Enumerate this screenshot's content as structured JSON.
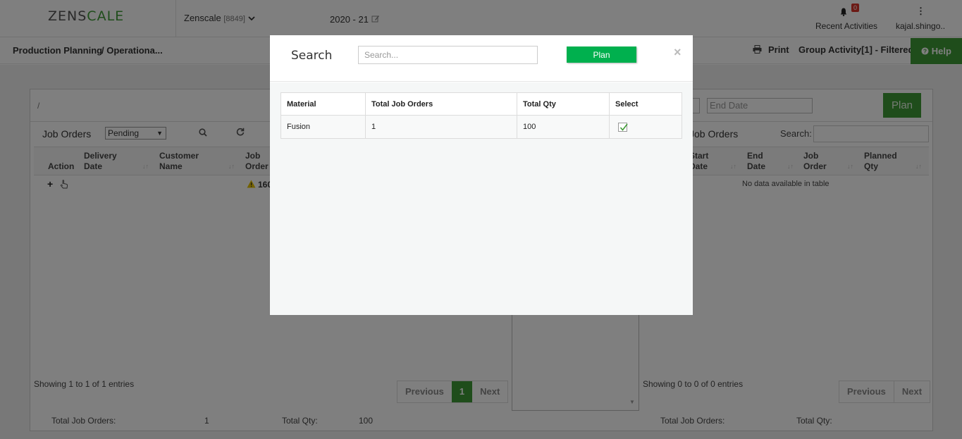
{
  "header": {
    "logo_left": "ZENS",
    "logo_right": "C",
    "logo_tail": "ALE",
    "company_name": "Zenscale",
    "company_code": "[8849]",
    "fiscal_year": "2020 - 21",
    "notification_count": "0",
    "recent_label": "Recent Activities",
    "username": "kajal.shingo..",
    "kebab": "⋮"
  },
  "subheader": {
    "crumb_root": "Production Planning",
    "crumb_current": "/ Operationa...",
    "print_label": "Print",
    "group_label": "Group Activity[1] - Filtered",
    "help_label": "Help"
  },
  "filter": {
    "slash": "/",
    "end_date_placeholder": "End Date",
    "plan_label": "Plan"
  },
  "left_table": {
    "title": "Job Orders",
    "status_value": "Pending",
    "columns": [
      "Action",
      "Delivery",
      "Date",
      "Customer",
      "Name",
      "Job",
      "Order"
    ],
    "row_job_order": "160",
    "showing": "Showing 1 to 1 of 1 entries",
    "pager": {
      "prev": "Previous",
      "current": "1",
      "next": "Next"
    },
    "totals": {
      "jo_label": "Total Job Orders:",
      "jo_value": "1",
      "qty_label": "Total Qty:",
      "qty_value": "100"
    }
  },
  "right_table": {
    "title": "Job Orders",
    "search_label": "Search:",
    "columns": [
      "Start",
      "Date",
      "End",
      "Date",
      "Job",
      "Order",
      "Planned",
      "Qty"
    ],
    "no_data": "No data available in table",
    "showing": "Showing 0 to 0 of 0 entries",
    "pager": {
      "prev": "Previous",
      "next": "Next"
    },
    "totals": {
      "jo_label": "Total Job Orders:",
      "qty_label": "Total Qty:"
    }
  },
  "modal": {
    "title": "Search",
    "search_placeholder": "Search...",
    "plan_label": "Plan",
    "close": "×",
    "columns": {
      "material": "Material",
      "total_job_orders": "Total Job Orders",
      "total_qty": "Total Qty",
      "select": "Select"
    },
    "rows": [
      {
        "material": "Fusion",
        "total_job_orders": "1",
        "total_qty": "100",
        "selected": true
      }
    ]
  },
  "colors": {
    "brand_green": "#3f9b36",
    "plan_green": "#00b04e",
    "badge_red": "#d9342b"
  }
}
